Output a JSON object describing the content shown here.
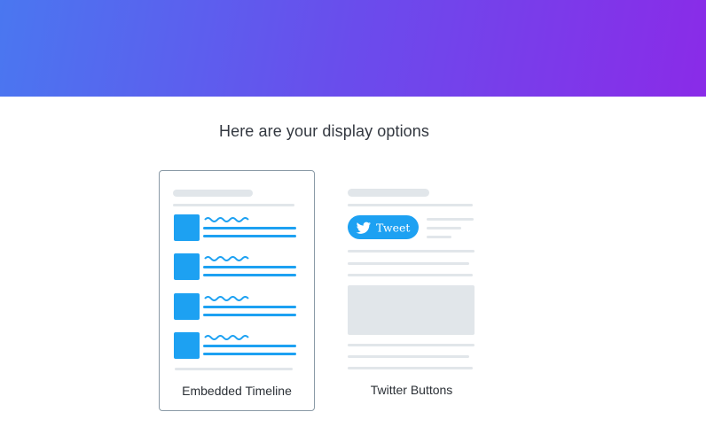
{
  "hero": {
    "gradient_start": "#4a77f0",
    "gradient_end": "#8a2be8"
  },
  "heading": "Here are your display options",
  "options": [
    {
      "label": "Embedded Timeline",
      "selected": true,
      "illustration": "timeline-preview"
    },
    {
      "label": "Twitter Buttons",
      "selected": false,
      "illustration": "buttons-preview",
      "tweet_button_label": "Tweet",
      "tweet_icon": "twitter-bird-icon"
    }
  ],
  "colors": {
    "twitter_blue": "#1da1f2",
    "placeholder_gray": "#e1e6ea",
    "selected_border": "#8a9aa6"
  }
}
